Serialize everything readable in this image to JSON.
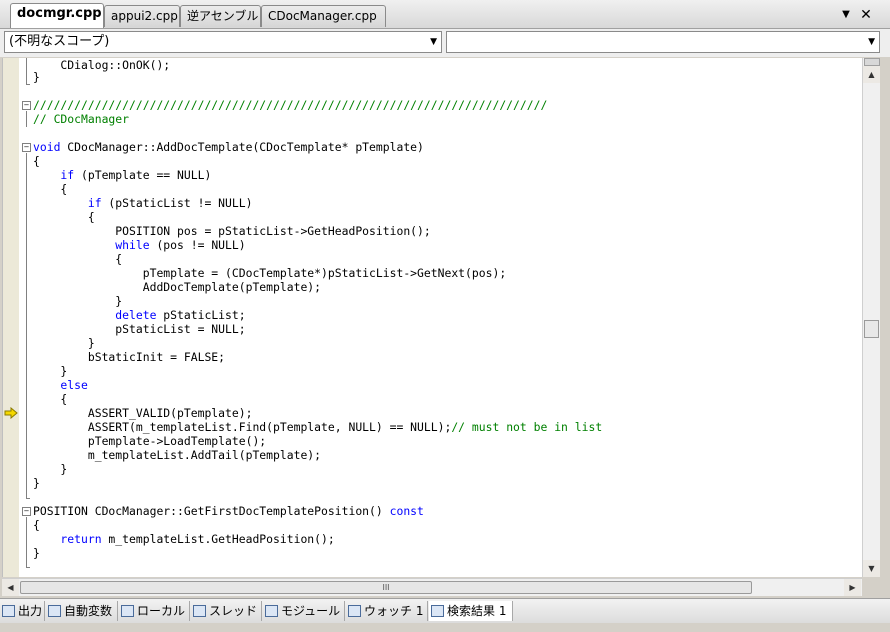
{
  "document_tabs": [
    "docmgr.cpp",
    "appui2.cpp",
    "逆アセンブル",
    "CDocManager.cpp"
  ],
  "tab_controls": {
    "menu": "▼",
    "close": "✕"
  },
  "scope_combo": {
    "left_value": "(不明なスコープ)",
    "right_value": ""
  },
  "code": {
    "l0": "    CDialog::OnOK();",
    "l1": "}",
    "l3": "///////////////////////////////////////////////////////////////////////////",
    "l4": "// CDocManager",
    "l6a": "void",
    "l6b": " CDocManager::AddDocTemplate(CDocTemplate* pTemplate)",
    "l7": "{",
    "l8a": "    if",
    "l8b": " (pTemplate == NULL)",
    "l9": "    {",
    "l10a": "        if",
    "l10b": " (pStaticList != NULL)",
    "l11": "        {",
    "l12": "            POSITION pos = pStaticList->GetHeadPosition();",
    "l13a": "            while",
    "l13b": " (pos != NULL)",
    "l14": "            {",
    "l15": "                pTemplate = (CDocTemplate*)pStaticList->GetNext(pos);",
    "l16": "                AddDocTemplate(pTemplate);",
    "l17": "            }",
    "l18a": "            delete",
    "l18b": " pStaticList;",
    "l19": "            pStaticList = NULL;",
    "l20": "        }",
    "l21": "        bStaticInit = FALSE;",
    "l22": "    }",
    "l23a": "    else",
    "l24": "    {",
    "l25": "        ASSERT_VALID(pTemplate);",
    "l26a": "        ASSERT(m_templateList.Find(pTemplate, NULL) == NULL);",
    "l26b": "// must not be in list",
    "l27": "        pTemplate->LoadTemplate();",
    "l28": "        m_templateList.AddTail(pTemplate);",
    "l29": "    }",
    "l30": "}",
    "l32a": "POSITION CDocManager::GetFirstDocTemplatePosition() ",
    "l32b": "const",
    "l33": "{",
    "l34a": "    return",
    "l34b": " m_templateList.GetHeadPosition();",
    "l35": "}"
  },
  "bottom_tabs": [
    "出力",
    "自動変数",
    "ローカル",
    "スレッド",
    "モジュール",
    "ウォッチ 1",
    "検索結果 1"
  ],
  "hscroll_grip": "III",
  "colors": {
    "keyword": "#0000ff",
    "comment": "#008000",
    "current_line_arrow": "#f5d800"
  }
}
